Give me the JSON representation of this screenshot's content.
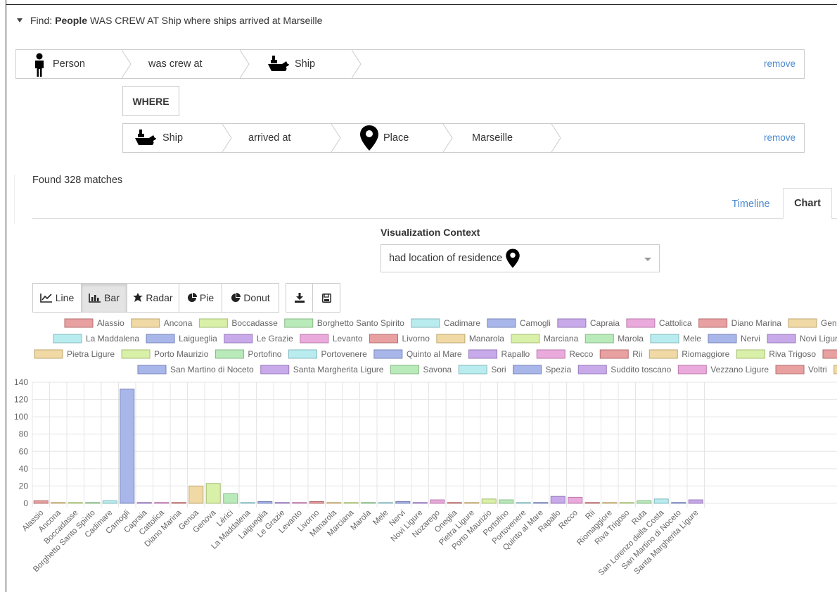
{
  "find": {
    "prefix": "Find:",
    "entity": "People",
    "rest": "WAS CREW AT Ship where ships arrived at Marseille"
  },
  "row1": {
    "person": "Person",
    "relation": "was crew at",
    "ship": "Ship",
    "remove": "remove"
  },
  "where": "WHERE",
  "row2": {
    "ship": "Ship",
    "relation": "arrived at",
    "place": "Place",
    "value": "Marseille",
    "remove": "remove"
  },
  "found_text": "Found 328 matches",
  "tabs": {
    "timeline": "Timeline",
    "chart": "Chart"
  },
  "visualization": {
    "label": "Visualization Context",
    "selected": "had location of residence"
  },
  "chart_types": [
    {
      "label": "Line",
      "icon": "line-chart-icon"
    },
    {
      "label": "Bar",
      "icon": "bar-chart-icon",
      "active": true
    },
    {
      "label": "Radar",
      "icon": "radar-icon"
    },
    {
      "label": "Pie",
      "icon": "pie-chart-icon"
    },
    {
      "label": "Donut",
      "icon": "donut-chart-icon"
    }
  ],
  "actions": [
    {
      "icon": "download-icon"
    },
    {
      "icon": "save-icon"
    }
  ],
  "chart_data": {
    "type": "bar",
    "ylim": [
      0,
      140
    ],
    "yticks": [
      0,
      20,
      40,
      60,
      80,
      100,
      120,
      140
    ],
    "categories": [
      "Alassio",
      "Ancona",
      "Boccadasse",
      "Borghetto Santo Spirito",
      "Cadimare",
      "Camogli",
      "Capraia",
      "Cattolica",
      "Diano Marina",
      "Genoa",
      "Genova",
      "Lérici",
      "La Maddalena",
      "Laigueglia",
      "Le Grazie",
      "Levanto",
      "Livorno",
      "Manarola",
      "Marciana",
      "Marola",
      "Mele",
      "Nervi",
      "Novi Ligure",
      "Nozarego",
      "Oneglia",
      "Pietra Ligure",
      "Porto Maurizio",
      "Portofino",
      "Portovenere",
      "Quinto al Mare",
      "Rapallo",
      "Recco",
      "Rii",
      "Riomaggiore",
      "Riva Trigoso",
      "Ruta",
      "San Lorenzo della Costa",
      "San Martino di Noceto",
      "Santa Margherita Ligure"
    ],
    "values": [
      3,
      1,
      1,
      1,
      3,
      132,
      1,
      1,
      1,
      20,
      23,
      11,
      1,
      2,
      1,
      1,
      2,
      1,
      1,
      1,
      1,
      2,
      1,
      4,
      1,
      1,
      5,
      4,
      1,
      1,
      8,
      7,
      1,
      1,
      1,
      3,
      5,
      1,
      4
    ],
    "legend_rows": [
      [
        "Alassio",
        "Ancona",
        "Boccadasse",
        "Borghetto Santo Spirito",
        "Cadimare",
        "Camogli",
        "Capraia",
        "Cattolica",
        "Diano Marina",
        "Geno"
      ],
      [
        "La Maddalena",
        "Laigueglia",
        "Le Grazie",
        "Levanto",
        "Livorno",
        "Manarola",
        "Marciana",
        "Marola",
        "Mele",
        "Nervi",
        "Novi Ligure"
      ],
      [
        "Pietra Ligure",
        "Porto Maurizio",
        "Portofino",
        "Portovenere",
        "Quinto al Mare",
        "Rapallo",
        "Recco",
        "Rii",
        "Riomaggiore",
        "Riva Trigoso",
        ""
      ],
      [
        "San Martino di Noceto",
        "Santa Margherita Ligure",
        "Savona",
        "Sori",
        "Spezia",
        "Suddito toscano",
        "Vezzano Ligure",
        "Voltri",
        ""
      ]
    ],
    "palette": [
      "#e8a0a0",
      "#f0d9a4",
      "#d9f0a8",
      "#b9eab9",
      "#b8ecef",
      "#a9b6ea",
      "#c8aaea",
      "#eaaadc"
    ],
    "grid": true,
    "legend_position": "top"
  }
}
